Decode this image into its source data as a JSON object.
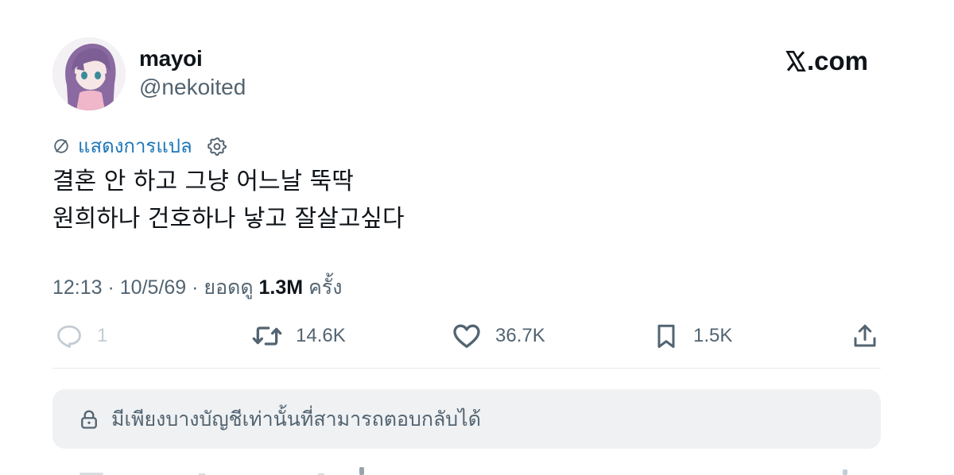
{
  "author": {
    "display_name": "mayoi",
    "handle": "@nekoited"
  },
  "brand": {
    "logo_text": ".com",
    "accent": "#0f1419"
  },
  "translate": {
    "label": "แสดงการแปล",
    "color": "#1d77b8"
  },
  "tweet": {
    "line1": "결혼 안 하고 그냥 어느날 뚝딱",
    "line2": "원희하나 건호하나 낳고 잘살고싶다"
  },
  "meta": {
    "time": "12:13",
    "separator": " · ",
    "date": "10/5/69",
    "views_prefix": "ยอดดู",
    "views_count": "1.3M",
    "views_suffix": "ครั้ง"
  },
  "actions": {
    "reply_count": "1",
    "retweet_count": "14.6K",
    "like_count": "36.7K",
    "bookmark_count": "1.5K"
  },
  "reply_restriction": {
    "label": "มีเพียงบางบัญชีเท่านั้นที่สามารถตอบกลับได้"
  },
  "icons": [
    "avatar",
    "x-logo-icon",
    "translate-globe-icon",
    "settings-gear-icon",
    "reply-icon",
    "retweet-icon",
    "like-icon",
    "bookmark-icon",
    "share-icon",
    "lock-icon"
  ]
}
